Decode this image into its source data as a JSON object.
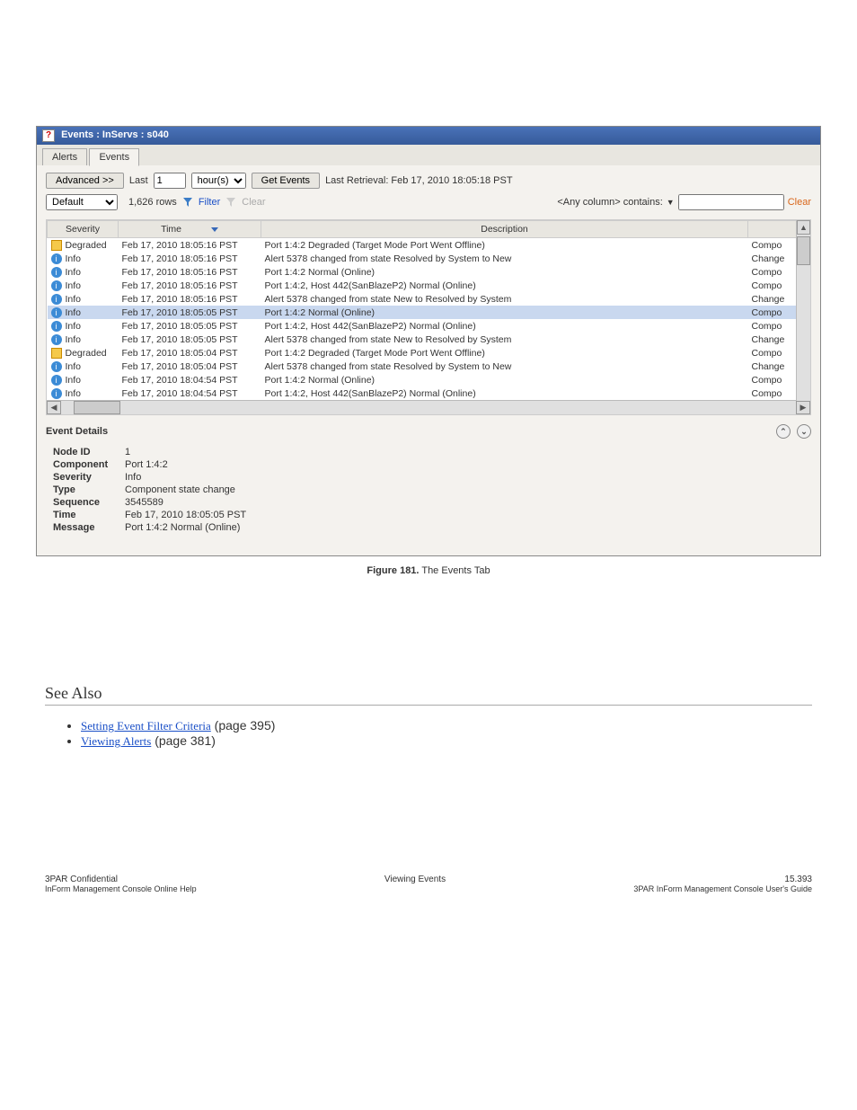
{
  "window": {
    "title": "Events : InServs : s040"
  },
  "tabs": [
    "Alerts",
    "Events"
  ],
  "activeTab": 1,
  "toolbar": {
    "advanced": "Advanced >>",
    "last_label": "Last",
    "last_value": "1",
    "last_unit": "hour(s)",
    "get_events": "Get Events",
    "last_retrieval": "Last Retrieval: Feb 17, 2010 18:05:18 PST",
    "preset": "Default",
    "row_count": "1,626 rows",
    "filter_label": "Filter",
    "clear_label": "Clear",
    "search_hint": "<Any column> contains:",
    "search_clear": "Clear"
  },
  "columns": {
    "severity": "Severity",
    "time": "Time",
    "description": "Description"
  },
  "rows": [
    {
      "sev": "Degraded",
      "icon": "deg",
      "time": "Feb 17, 2010 18:05:16 PST",
      "desc": "Port 1:4:2 Degraded (Target Mode Port Went Offline)",
      "type": "Compo"
    },
    {
      "sev": "Info",
      "icon": "info",
      "time": "Feb 17, 2010 18:05:16 PST",
      "desc": "Alert 5378 changed from state Resolved by System to New",
      "type": "Change"
    },
    {
      "sev": "Info",
      "icon": "info",
      "time": "Feb 17, 2010 18:05:16 PST",
      "desc": "Port 1:4:2 Normal (Online)",
      "type": "Compo"
    },
    {
      "sev": "Info",
      "icon": "info",
      "time": "Feb 17, 2010 18:05:16 PST",
      "desc": "Port 1:4:2, Host 442(SanBlazeP2) Normal (Online)",
      "type": "Compo"
    },
    {
      "sev": "Info",
      "icon": "info",
      "time": "Feb 17, 2010 18:05:16 PST",
      "desc": "Alert 5378 changed from state New to Resolved by System",
      "type": "Change"
    },
    {
      "sev": "Info",
      "icon": "info",
      "time": "Feb 17, 2010 18:05:05 PST",
      "desc": "Port 1:4:2 Normal (Online)",
      "type": "Compo",
      "selected": true
    },
    {
      "sev": "Info",
      "icon": "info",
      "time": "Feb 17, 2010 18:05:05 PST",
      "desc": "Port 1:4:2, Host 442(SanBlazeP2) Normal (Online)",
      "type": "Compo"
    },
    {
      "sev": "Info",
      "icon": "info",
      "time": "Feb 17, 2010 18:05:05 PST",
      "desc": "Alert 5378 changed from state New to Resolved by System",
      "type": "Change"
    },
    {
      "sev": "Degraded",
      "icon": "deg",
      "time": "Feb 17, 2010 18:05:04 PST",
      "desc": "Port 1:4:2 Degraded (Target Mode Port Went Offline)",
      "type": "Compo"
    },
    {
      "sev": "Info",
      "icon": "info",
      "time": "Feb 17, 2010 18:05:04 PST",
      "desc": "Alert 5378 changed from state Resolved by System to New",
      "type": "Change"
    },
    {
      "sev": "Info",
      "icon": "info",
      "time": "Feb 17, 2010 18:04:54 PST",
      "desc": "Port 1:4:2 Normal (Online)",
      "type": "Compo"
    },
    {
      "sev": "Info",
      "icon": "info",
      "time": "Feb 17, 2010 18:04:54 PST",
      "desc": "Port 1:4:2, Host 442(SanBlazeP2) Normal (Online)",
      "type": "Compo"
    }
  ],
  "details": {
    "header": "Event Details",
    "fields": {
      "Node ID": "1",
      "Component": "Port 1:4:2",
      "Severity": "Info",
      "Type": "Component state change",
      "Sequence": "3545589",
      "Time": "Feb 17, 2010 18:05:05 PST",
      "Message": "Port 1:4:2 Normal (Online)"
    }
  },
  "caption": {
    "label": "Figure 181.",
    "text": " The Events Tab"
  },
  "see_also": {
    "heading": "See Also",
    "links": [
      {
        "text": "Setting Event Filter Criteria",
        "page": "(page 395)"
      },
      {
        "text": "Viewing Alerts",
        "page": "(page 381)"
      }
    ]
  },
  "footer": {
    "left": "3PAR Confidential",
    "center": "Viewing Events",
    "right": "15.393",
    "sub_left": "InForm Management Console Online Help",
    "sub_right": "3PAR InForm Management Console User's Guide"
  }
}
